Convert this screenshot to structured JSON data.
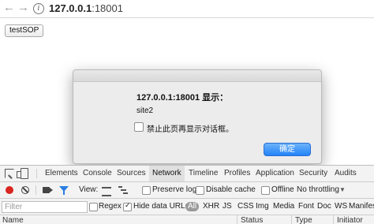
{
  "browser": {
    "back_icon": "back-arrow-icon",
    "forward_icon": "forward-arrow-icon",
    "info_icon": "info-icon",
    "url_host": "127.0.0.1",
    "url_port": ":18001"
  },
  "page": {
    "button_label": "testSOP"
  },
  "dialog": {
    "title": "127.0.0.1:18001 显示：",
    "message": "site2",
    "checkbox_label": "禁止此页再显示对话框。",
    "checkbox_checked": false,
    "ok_label": "确定",
    "ok_color": "#2383f8"
  },
  "devtools": {
    "tabs": [
      "Elements",
      "Console",
      "Sources",
      "Network",
      "Timeline",
      "Profiles",
      "Application",
      "Security",
      "Audits"
    ],
    "active_tab": "Network",
    "network_toolbar": {
      "record_color": "#d9241f",
      "view_label": "View:",
      "preserve_log_label": "Preserve log",
      "disable_cache_label": "Disable cache",
      "offline_label": "Offline",
      "throttling_label": "No throttling"
    },
    "filter": {
      "placeholder": "Filter",
      "regex_label": "Regex",
      "hide_data_urls_label": "Hide data URLs",
      "hide_data_urls_checked": true,
      "types": [
        "All",
        "XHR",
        "JS",
        "CSS",
        "Img",
        "Media",
        "Font",
        "Doc",
        "WS",
        "Manifest"
      ],
      "active_type": "All"
    },
    "table_headers": [
      "Name",
      "Status",
      "Type",
      "Initiator"
    ]
  }
}
